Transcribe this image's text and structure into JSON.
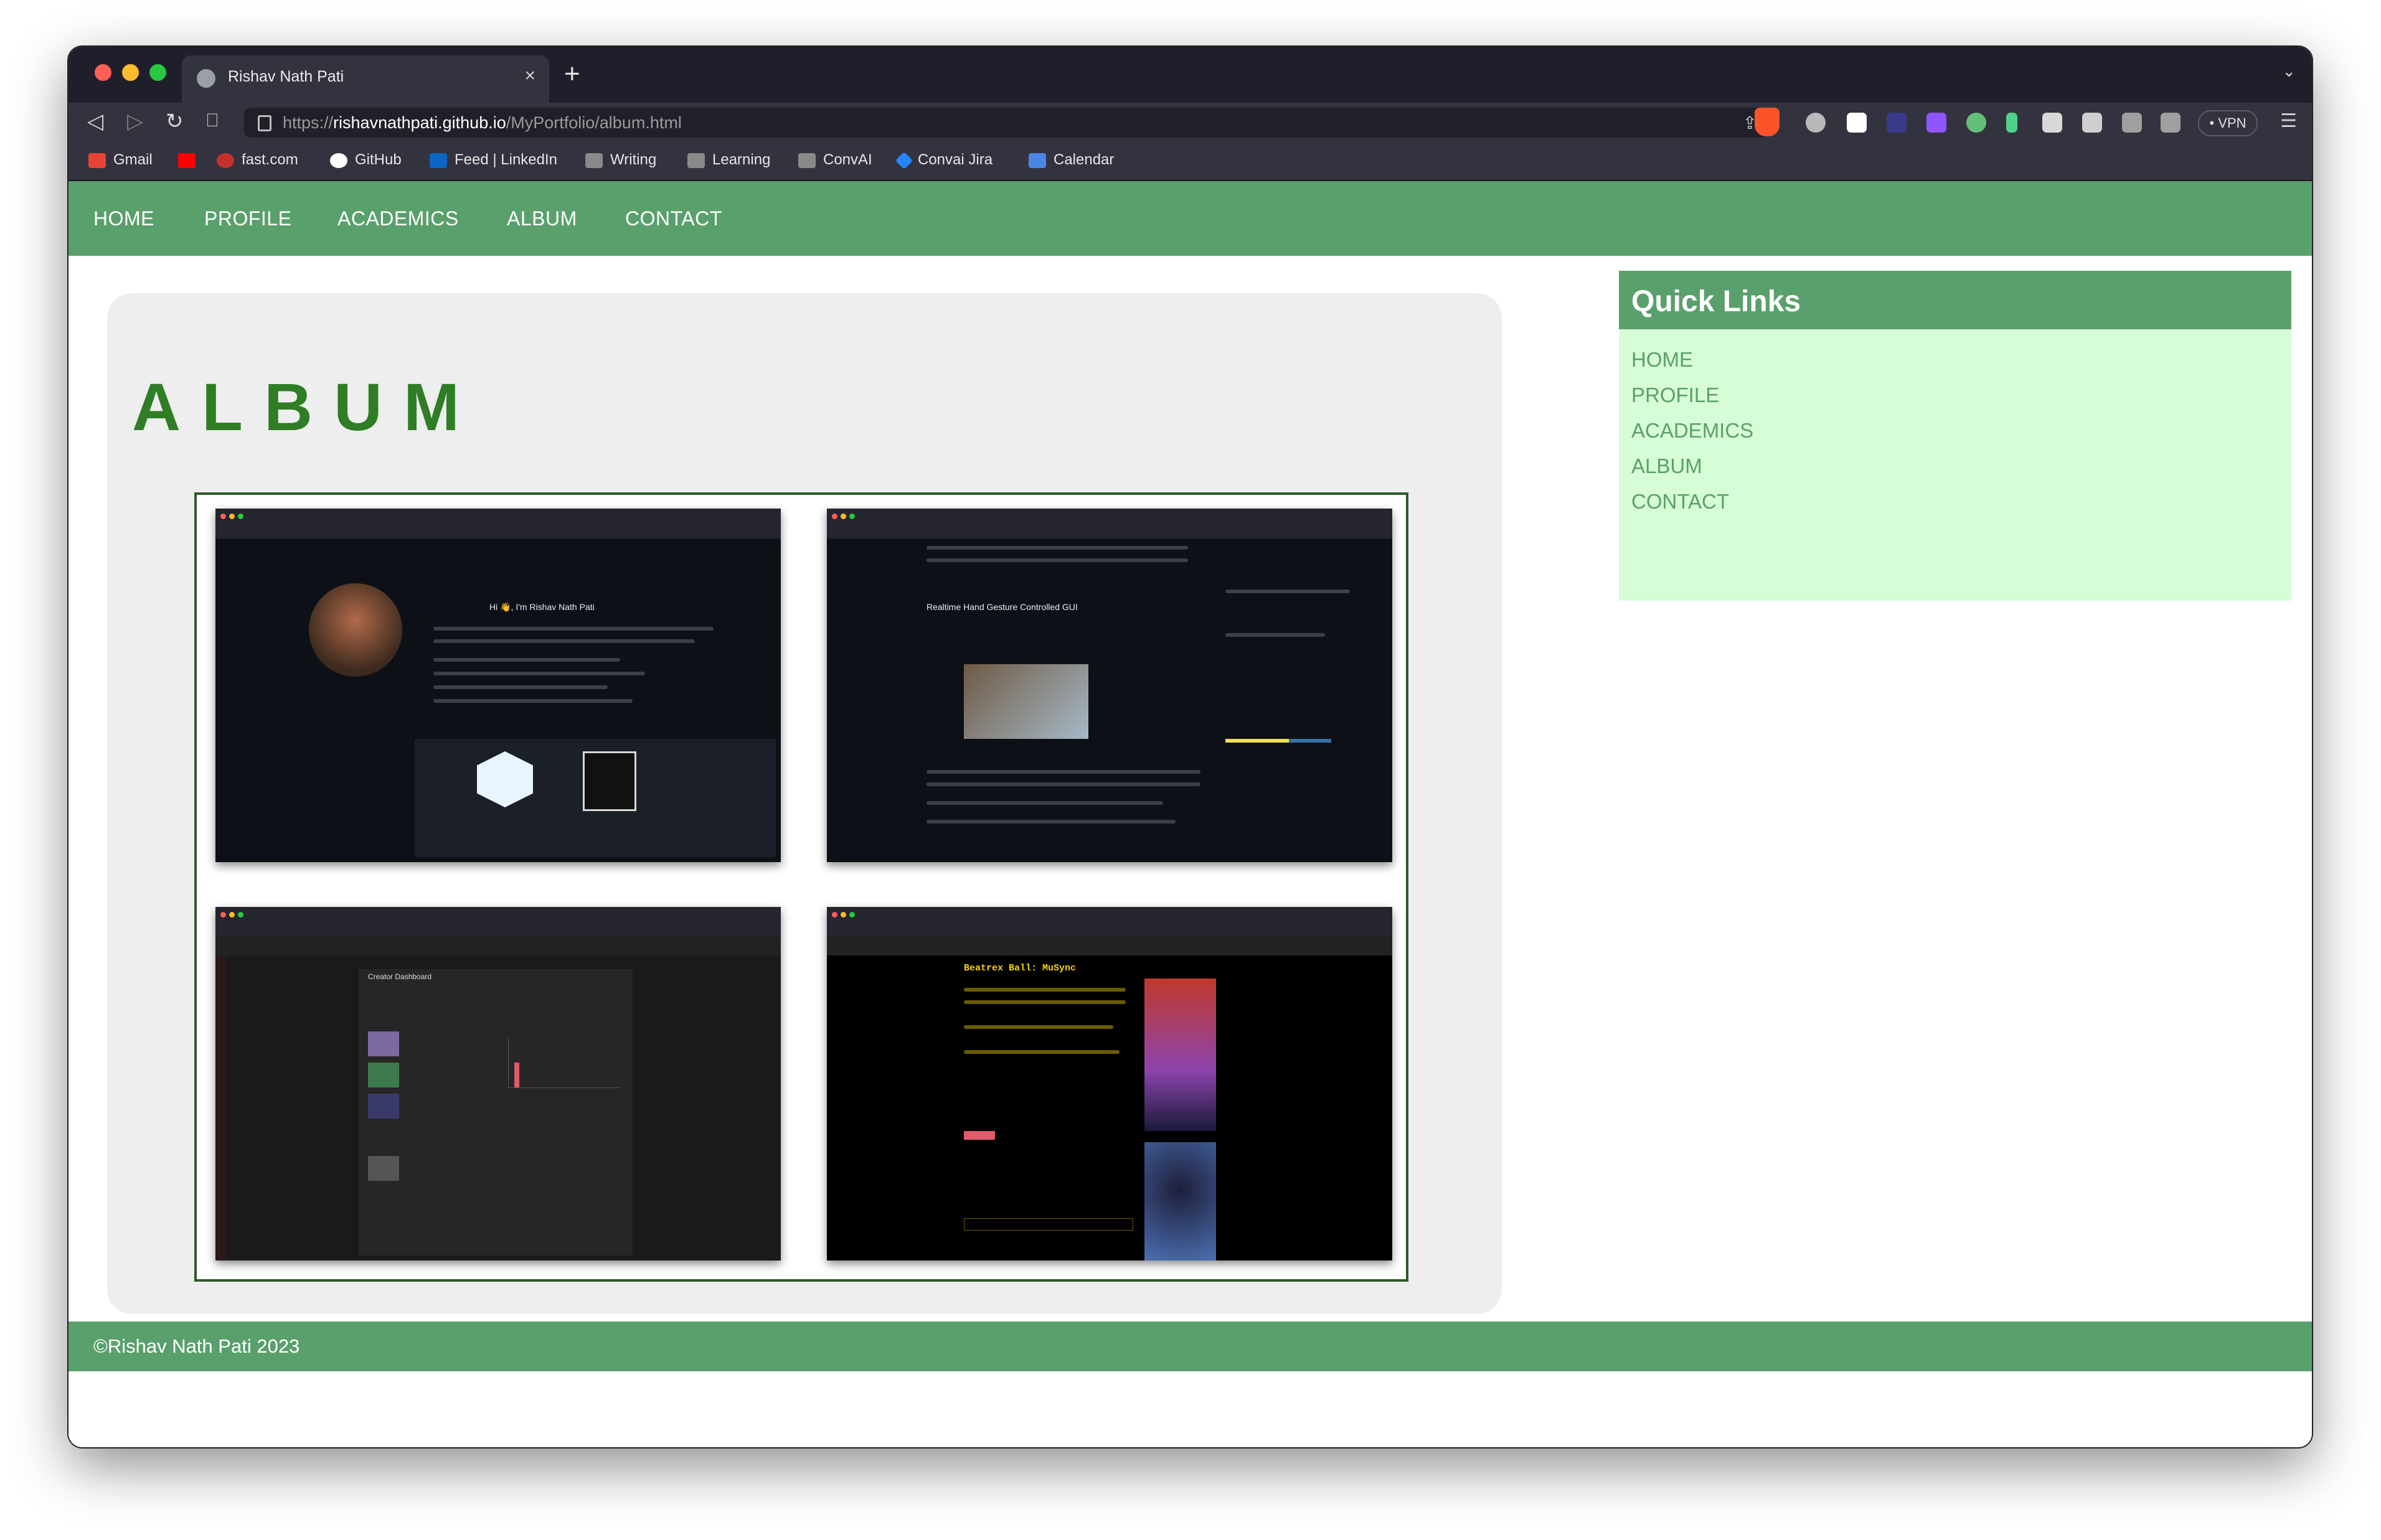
{
  "browser": {
    "tab_title": "Rishav Nath Pati",
    "tab_close": "×",
    "new_tab": "+",
    "url_scheme": "https://",
    "url_host": "rishavnathpati.github.io",
    "url_path": "/MyPortfolio/album.html",
    "vpn_label": "• VPN",
    "bookmarks": [
      "Gmail",
      "fast.com",
      "GitHub",
      "Feed | LinkedIn",
      "Writing",
      "Learning",
      "ConvAI",
      "Convai Jira",
      "Calendar"
    ]
  },
  "nav": {
    "items": [
      "HOME",
      "PROFILE",
      "ACADEMICS",
      "ALBUM",
      "CONTACT"
    ]
  },
  "album": {
    "title": "ALBUM",
    "photos": [
      {
        "icon": "github-profile-screenshot",
        "heading": "Hi 👋, I'm Rishav Nath Pati"
      },
      {
        "icon": "github-repo-screenshot",
        "heading": "Realtime Hand Gesture Controlled GUI"
      },
      {
        "icon": "itch-dashboard-screenshot",
        "heading": "Creator Dashboard"
      },
      {
        "icon": "itch-game-screenshot",
        "heading": "Beatrex Ball: MuSync"
      }
    ]
  },
  "quick_links": {
    "title": "Quick Links",
    "items": [
      "HOME",
      "PROFILE",
      "ACADEMICS",
      "ALBUM",
      "CONTACT"
    ]
  },
  "footer": {
    "text": "©Rishav Nath Pati 2023"
  },
  "colors": {
    "brand_green": "#5aa06c",
    "album_title_green": "#2f7d25",
    "sidebar_bg": "#d6fdd6"
  }
}
